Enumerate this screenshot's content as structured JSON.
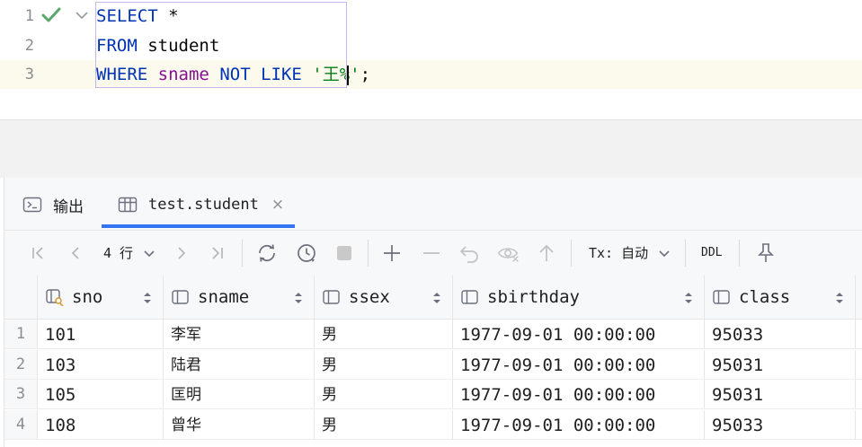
{
  "editor": {
    "lines": [
      {
        "num": "1",
        "tokens": [
          {
            "t": "SELECT",
            "c": "kw"
          },
          {
            "t": " ",
            "c": "plain"
          },
          {
            "t": "*",
            "c": "plain"
          }
        ]
      },
      {
        "num": "2",
        "tokens": [
          {
            "t": "FROM",
            "c": "kw"
          },
          {
            "t": " student",
            "c": "plain"
          }
        ]
      },
      {
        "num": "3",
        "tokens": [
          {
            "t": "WHERE",
            "c": "kw"
          },
          {
            "t": " ",
            "c": "plain"
          },
          {
            "t": "sname",
            "c": "id"
          },
          {
            "t": " ",
            "c": "plain"
          },
          {
            "t": "NOT LIKE",
            "c": "kw"
          },
          {
            "t": " ",
            "c": "plain"
          },
          {
            "t": "'王%'",
            "c": "str"
          },
          {
            "t": ";",
            "c": "plain"
          }
        ]
      }
    ]
  },
  "tabs": {
    "output_label": "输出",
    "table_label": "test.student",
    "close_glyph": "×"
  },
  "toolbar": {
    "row_count": "4 行",
    "tx_label": "Tx: 自动",
    "ddl_label": "DDL"
  },
  "grid": {
    "columns": [
      {
        "name": "sno",
        "icon": "primary-key-column-icon"
      },
      {
        "name": "sname",
        "icon": "column-icon"
      },
      {
        "name": "ssex",
        "icon": "column-icon"
      },
      {
        "name": "sbirthday",
        "icon": "column-icon"
      },
      {
        "name": "class",
        "icon": "column-icon"
      }
    ],
    "rows": [
      {
        "num": "1",
        "cells": [
          "101",
          "李军",
          "男",
          "1977-09-01 00:00:00",
          "95033"
        ]
      },
      {
        "num": "2",
        "cells": [
          "103",
          "陆君",
          "男",
          "1977-09-01 00:00:00",
          "95031"
        ]
      },
      {
        "num": "3",
        "cells": [
          "105",
          "匡明",
          "男",
          "1977-09-01 00:00:00",
          "95031"
        ]
      },
      {
        "num": "4",
        "cells": [
          "108",
          "曾华",
          "男",
          "1977-09-01 00:00:00",
          "95033"
        ]
      }
    ]
  },
  "colors": {
    "keyword": "#0033b3",
    "identifier": "#871094",
    "string": "#067d17",
    "accent": "#3574f0",
    "check": "#59a869"
  }
}
